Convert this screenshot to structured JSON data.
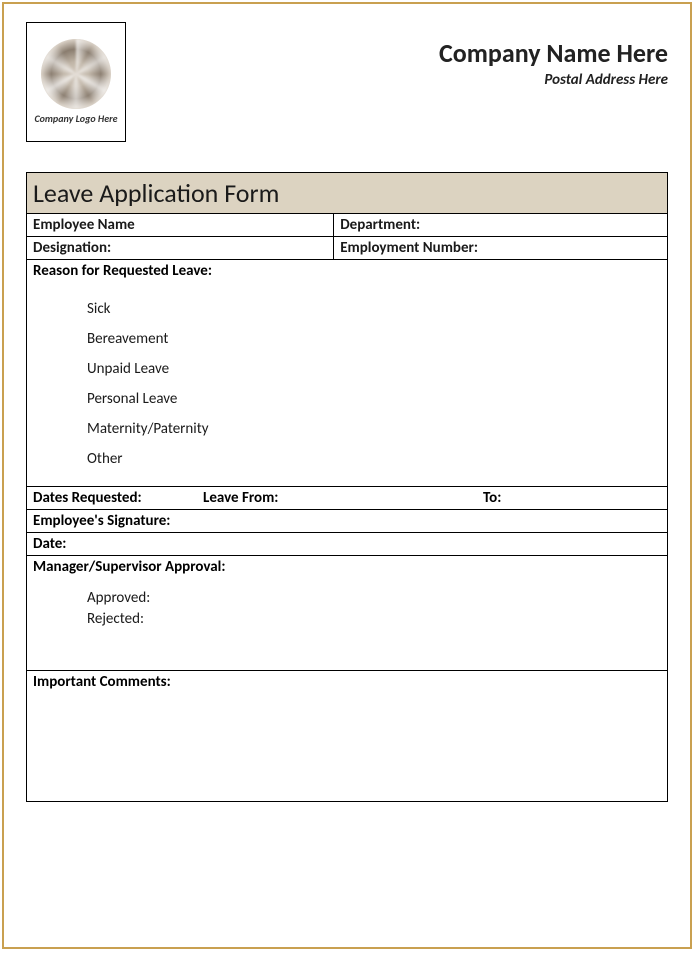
{
  "header": {
    "logo_text": "Company Logo Here",
    "company_name": "Company Name Here",
    "postal_address": "Postal Address Here"
  },
  "form": {
    "title": "Leave Application Form",
    "employee_name_label": "Employee Name",
    "department_label": "Department:",
    "designation_label": "Designation:",
    "employment_number_label": "Employment Number:",
    "reason_label": "Reason for Requested Leave:",
    "reasons": [
      "Sick",
      "Bereavement",
      "Unpaid Leave",
      "Personal Leave",
      "Maternity/Paternity",
      "Other"
    ],
    "dates_requested_label": "Dates Requested:",
    "leave_from_label": "Leave From:",
    "to_label": "To:",
    "signature_label": "Employee's Signature:",
    "date_label": "Date:",
    "approval_label": "Manager/Supervisor Approval:",
    "approval_options": [
      "Approved:",
      "Rejected:"
    ],
    "comments_label": "Important Comments:"
  }
}
